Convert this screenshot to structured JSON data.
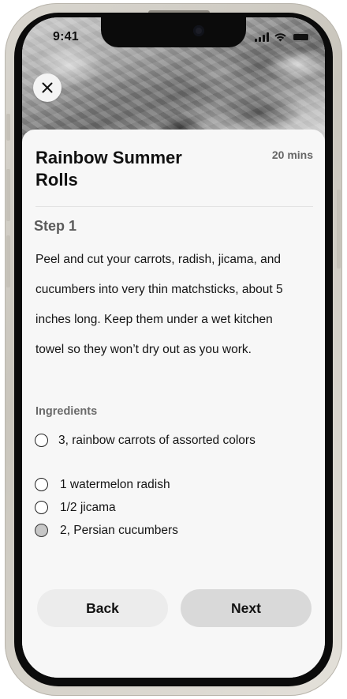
{
  "status_bar": {
    "time": "9:41"
  },
  "hero": {
    "image_description_icon": "summer-rolls-photo"
  },
  "header": {
    "close_icon": "close-icon"
  },
  "recipe": {
    "title": "Rainbow Summer Rolls",
    "duration": "20 mins"
  },
  "step": {
    "title": "Step 1",
    "text": "Peel and cut your carrots, radish, jicama, and cucumbers into very thin matchsticks, about 5 inches long. Keep them under a wet kitchen towel so they won’t dry out as you work."
  },
  "ingredients": {
    "label": "Ingredients",
    "items": [
      {
        "text": "3, rainbow carrots of assorted colors",
        "checked": false
      },
      {
        "text": "1 watermelon radish",
        "checked": false
      },
      {
        "text": "1/2 jicama",
        "checked": false
      },
      {
        "text": "2, Persian cucumbers",
        "checked": true
      }
    ]
  },
  "navigation": {
    "back_label": "Back",
    "next_label": "Next"
  },
  "colors": {
    "sheet_background": "#f7f7f7",
    "back_button": "#ececec",
    "next_button": "#d9d9d9",
    "text_primary": "#111111",
    "text_secondary": "#666666"
  }
}
